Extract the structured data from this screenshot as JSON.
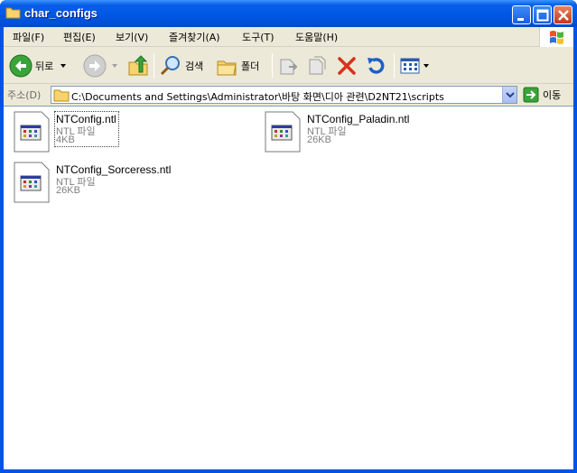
{
  "window": {
    "title": "char_configs"
  },
  "menu": [
    {
      "label": "파일(F)"
    },
    {
      "label": "편집(E)"
    },
    {
      "label": "보기(V)"
    },
    {
      "label": "즐겨찾기(A)"
    },
    {
      "label": "도구(T)"
    },
    {
      "label": "도움말(H)"
    }
  ],
  "toolbar": {
    "back_label": "뒤로",
    "search_label": "검색",
    "folders_label": "폴더"
  },
  "address": {
    "label": "주소(D)",
    "value": "C:\\Documents and Settings\\Administrator\\바탕 화면\\디아 관련\\D2NT21\\scripts",
    "go_label": "이동"
  },
  "files": [
    {
      "name": "NTConfig.ntl",
      "type": "NTL 파일",
      "size": "4KB",
      "selected": true
    },
    {
      "name": "NTConfig_Paladin.ntl",
      "type": "NTL 파일",
      "size": "26KB",
      "selected": false
    },
    {
      "name": "NTConfig_Sorceress.ntl",
      "type": "NTL 파일",
      "size": "26KB",
      "selected": false
    }
  ],
  "colors": {
    "title_bar": "#0054e3",
    "chrome": "#ece9d8",
    "close_button": "#c9361a"
  }
}
